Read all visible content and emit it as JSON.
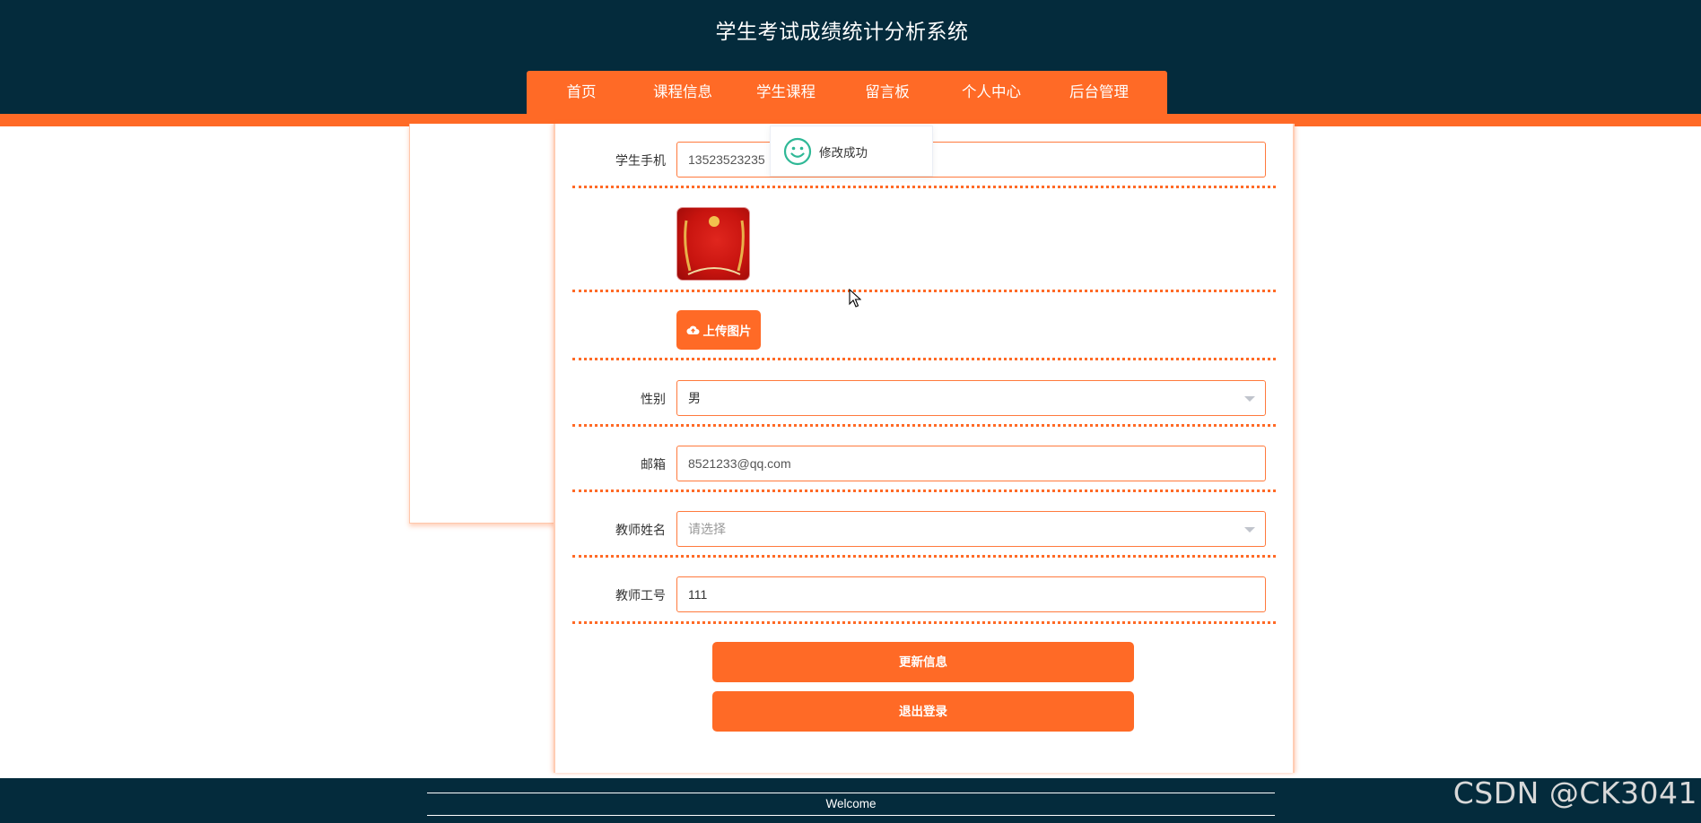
{
  "header": {
    "title": "学生考试成绩统计分析系统"
  },
  "nav": {
    "items": [
      {
        "label": "首页"
      },
      {
        "label": "课程信息"
      },
      {
        "label": "学生课程"
      },
      {
        "label": "留言板"
      },
      {
        "label": "个人中心"
      },
      {
        "label": "后台管理"
      }
    ]
  },
  "toast": {
    "icon": "smile-icon",
    "message": "修改成功",
    "color": "#2fb896"
  },
  "form": {
    "phone": {
      "label": "学生手机",
      "value": "13523523235"
    },
    "upload_label": "上传图片",
    "gender": {
      "label": "性别",
      "value": "男"
    },
    "email": {
      "label": "邮箱",
      "value": "8521233@qq.com"
    },
    "teacher_name": {
      "label": "教师姓名",
      "placeholder": "请选择"
    },
    "teacher_id": {
      "label": "教师工号",
      "value": "111"
    },
    "update_button": "更新信息",
    "logout_button": "退出登录"
  },
  "footer": {
    "text": "Welcome"
  },
  "watermark": "CSDN @CK3041",
  "colors": {
    "header_bg": "#042b3c",
    "accent": "#ff6a26"
  }
}
